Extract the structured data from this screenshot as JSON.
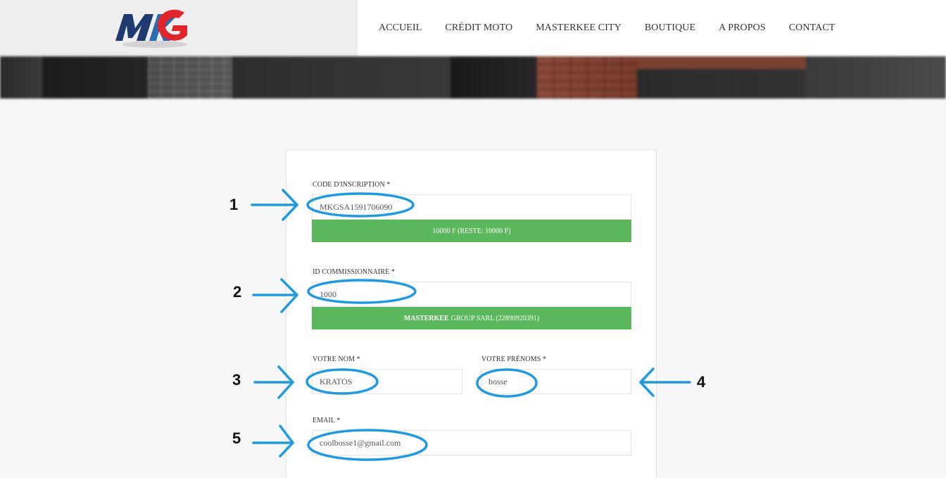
{
  "header": {
    "logo_text": "MKG",
    "nav": [
      "ACCUEIL",
      "CRÉDIT MOTO",
      "MASTERKEE CITY",
      "BOUTIQUE",
      "A PROPOS",
      "CONTACT"
    ]
  },
  "form": {
    "code_label": "CODE D'INSCRIPTION *",
    "code_value": "MKGSA1591706090",
    "code_status": "10000 F (RESTE: 10000 F)",
    "commission_label": "ID COMMISSIONNAIRE *",
    "commission_value": "1000",
    "commission_name_bold": "MASTERKEE",
    "commission_name_rest": "GROUP SARL (22890920391)",
    "nom_label": "VOTRE NOM *",
    "nom_value": "KRATOS",
    "prenoms_label": "VOTRE PRÉNOMS *",
    "prenoms_value": "bosse",
    "email_label": "EMAIL *",
    "email_value": "coolbosse1@gmail.com"
  },
  "annotations": {
    "numbers": [
      "1",
      "2",
      "3",
      "4",
      "5"
    ],
    "color": "#1e9be0"
  },
  "colors": {
    "green": "#5cb85c",
    "logo_blue": "#1f3a6e",
    "logo_red": "#e1262b"
  }
}
